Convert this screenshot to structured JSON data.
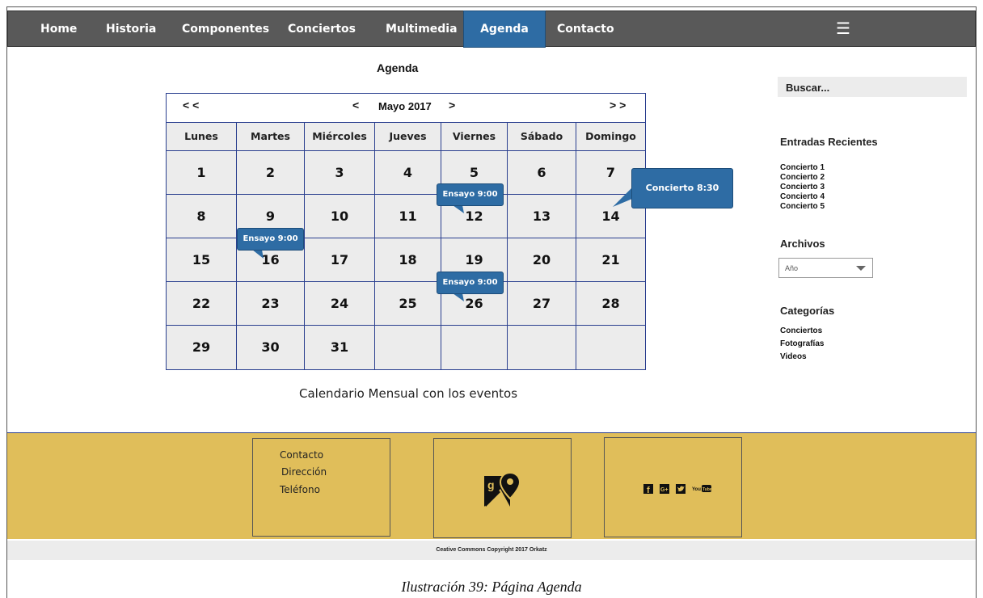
{
  "nav": {
    "items": [
      "Home",
      "Historia",
      "Componentes",
      "Conciertos",
      "Multimedia",
      "Agenda",
      "Contacto"
    ],
    "active": "Agenda",
    "menu_icon": "hamburger-icon"
  },
  "page_title": "Agenda",
  "calendar": {
    "prev_year": "< <",
    "prev_month": "<",
    "month": "Mayo 2017",
    "next_month": ">",
    "next_year": "> >",
    "weekdays": [
      "Lunes",
      "Martes",
      "Miércoles",
      "Jueves",
      "Viernes",
      "Sábado",
      "Domingo"
    ],
    "weeks": [
      [
        "1",
        "2",
        "3",
        "4",
        "5",
        "6",
        "7"
      ],
      [
        "8",
        "9",
        "10",
        "11",
        "12",
        "13",
        "14"
      ],
      [
        "15",
        "16",
        "17",
        "18",
        "19",
        "20",
        "21"
      ],
      [
        "22",
        "23",
        "24",
        "25",
        "26",
        "27",
        "28"
      ],
      [
        "29",
        "30",
        "31",
        "",
        "",
        "",
        ""
      ]
    ],
    "events": [
      {
        "day": "12",
        "label": "Ensayo 9:00"
      },
      {
        "day": "14",
        "label": "Concierto 8:30"
      },
      {
        "day": "16",
        "label": "Ensayo 9:00"
      },
      {
        "day": "26",
        "label": "Ensayo 9:00"
      }
    ],
    "event_color": "#2e6ca4"
  },
  "caption": "Calendario Mensual con los eventos",
  "sidebar": {
    "search": "Buscar...",
    "recent_title": "Entradas Recientes",
    "recent": [
      "Concierto 1",
      "Concierto 2",
      "Concierto 3",
      "Concierto 4",
      "Concierto 5"
    ],
    "archives_title": "Archivos",
    "year_select": "Año",
    "categories_title": "Categorías",
    "categories": [
      "Conciertos",
      "Fotografías",
      "Videos"
    ]
  },
  "footer": {
    "contact": [
      "Contacto",
      "Dirección",
      "Teléfono"
    ],
    "map_icon": "google-maps-icon",
    "social_icons": [
      "facebook-icon",
      "google-plus-icon",
      "twitter-icon",
      "youtube-icon"
    ],
    "copyright": "Ceative Commons Copyright 2017 Orkatz",
    "color": "#e0be5a"
  },
  "figure_caption": "Ilustración 39: Página Agenda"
}
